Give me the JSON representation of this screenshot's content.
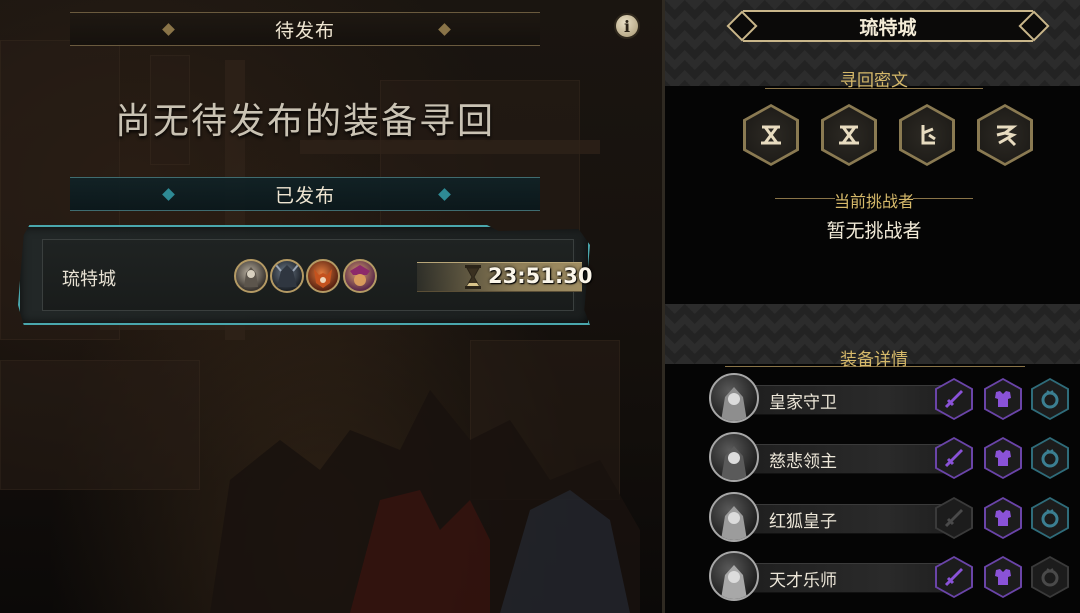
{
  "left": {
    "pending_title": "待发布",
    "empty_message": "尚无待发布的装备寻回",
    "published_title": "已发布",
    "info_icon": "i",
    "mission": {
      "city": "琉特城",
      "heroes": [
        "royal-guard-portrait",
        "merciful-lord-portrait",
        "red-fox-prince-portrait",
        "genius-musician-portrait"
      ],
      "timer": "23:51:30"
    }
  },
  "right": {
    "title": "琉特城",
    "cipher_label": "寻回密文",
    "runes": [
      "rune-glyph-1",
      "rune-glyph-2",
      "rune-glyph-3",
      "rune-glyph-4"
    ],
    "challenger_label": "当前挑战者",
    "challenger_value": "暂无挑战者",
    "details_label": "装备详情",
    "equipment": [
      {
        "name": "皇家守卫",
        "sword": "active",
        "armor": "active",
        "ring": "active"
      },
      {
        "name": "慈悲领主",
        "sword": "active",
        "armor": "active",
        "ring": "active"
      },
      {
        "name": "红狐皇子",
        "sword": "inactive",
        "armor": "active",
        "ring": "active"
      },
      {
        "name": "天才乐师",
        "sword": "active",
        "armor": "active",
        "ring": "inactive"
      }
    ]
  },
  "colors": {
    "gold": "#d6b96a",
    "cyan_glow": "#4aa7ad",
    "purple_gear": "#8a52d8",
    "blue_gear": "#3b7f92"
  }
}
